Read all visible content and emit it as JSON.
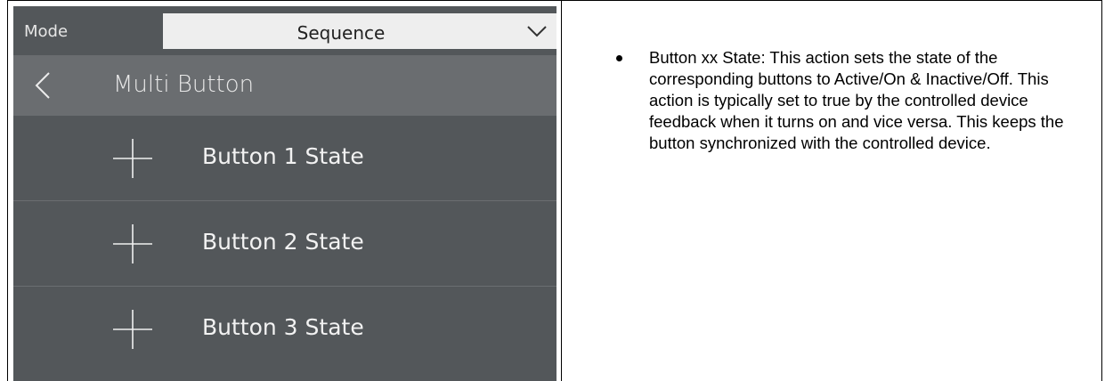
{
  "panel": {
    "mode_label": "Mode",
    "mode_value": "Sequence",
    "header_title": "Multi Button",
    "items": [
      {
        "label": "Button 1 State"
      },
      {
        "label": "Button 2 State"
      },
      {
        "label": "Button 3 State"
      }
    ],
    "colors": {
      "panel_bg": "#53575a",
      "header_bg": "#6a6d70",
      "select_bg": "#eeeeee"
    }
  },
  "description": {
    "bullets": [
      "Button xx State: This action sets the state of the corresponding buttons to Active/On & Inactive/Off. This action is typically set to true by the controlled device feedback when it turns on and vice versa. This keeps the button synchronized with the controlled device."
    ]
  }
}
